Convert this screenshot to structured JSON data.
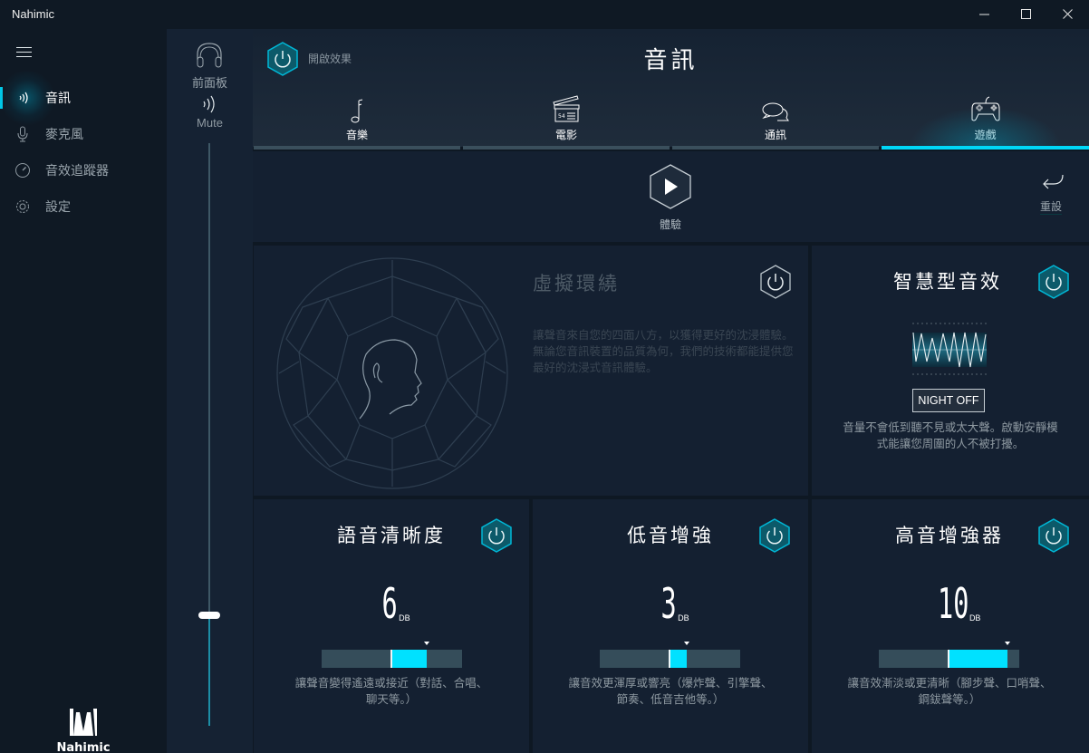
{
  "window": {
    "title": "Nahimic",
    "controls": {
      "minimize": "minimize-icon",
      "maximize": "maximize-icon",
      "close": "close-icon"
    }
  },
  "sidebar": {
    "menu_icon": "hamburger-icon",
    "items": [
      {
        "label": "音訊",
        "icon": "sound-waves-icon",
        "active": true
      },
      {
        "label": "麥克風",
        "icon": "microphone-icon",
        "active": false
      },
      {
        "label": "音效追蹤器",
        "icon": "gauge-icon",
        "active": false
      },
      {
        "label": "設定",
        "icon": "gear-icon",
        "active": false
      }
    ],
    "logo_text": "Nahimic"
  },
  "volume_panel": {
    "device_label": "前面板",
    "device_icon": "headphones-icon",
    "mute_label": "Mute",
    "mute_icon": "speaker-waves-icon",
    "volume_fraction": 0.19
  },
  "header": {
    "effects_toggle_label": "開啟效果",
    "effects_on": true,
    "title": "音訊",
    "tabs": [
      {
        "label": "音樂",
        "icon": "music-note-icon",
        "active": false
      },
      {
        "label": "電影",
        "icon": "clapperboard-icon",
        "active": false
      },
      {
        "label": "通訊",
        "icon": "chat-bubbles-icon",
        "active": false
      },
      {
        "label": "遊戲",
        "icon": "gamepad-icon",
        "active": true
      }
    ]
  },
  "actions": {
    "play_label": "體驗",
    "reset_label": "重設"
  },
  "cards": {
    "surround": {
      "title": "虛擬環繞",
      "enabled": false,
      "description": "讓聲音來自您的四面八方，以獲得更好的沈浸體驗。無論您音訊裝置的品質為何，我們的技術都能提供您最好的沈浸式音訊體驗。"
    },
    "smart_volume": {
      "title": "智慧型音效",
      "enabled": true,
      "night_button": "NIGHT OFF",
      "description": "音量不會低到聽不見或太大聲。啟動安靜模式能讓您周圍的人不被打擾。"
    },
    "voice_clarity": {
      "title": "語音清晰度",
      "enabled": true,
      "value": "6",
      "unit": "DB",
      "level_db": 6,
      "range_db": 12,
      "description": "讓聲音變得遙遠或接近（對話、合唱、聊天等。）"
    },
    "bass_boost": {
      "title": "低音增強",
      "enabled": true,
      "value": "3",
      "unit": "DB",
      "level_db": 3,
      "range_db": 12,
      "description": "讓音效更渾厚或響亮（爆炸聲、引擎聲、節奏、低音吉他等。）"
    },
    "treble_boost": {
      "title": "高音增強器",
      "enabled": true,
      "value": "10",
      "unit": "DB",
      "level_db": 10,
      "range_db": 12,
      "description": "讓音效漸淡或更清晰（腳步聲、口哨聲、鋼鈸聲等。）"
    }
  },
  "colors": {
    "accent": "#00d7f7",
    "bar_fill": "#00e1ff",
    "bar_track": "#354d5a",
    "toggle_on_fill": "#0c5a6a",
    "toggle_on_stroke": "#00b7d6"
  }
}
